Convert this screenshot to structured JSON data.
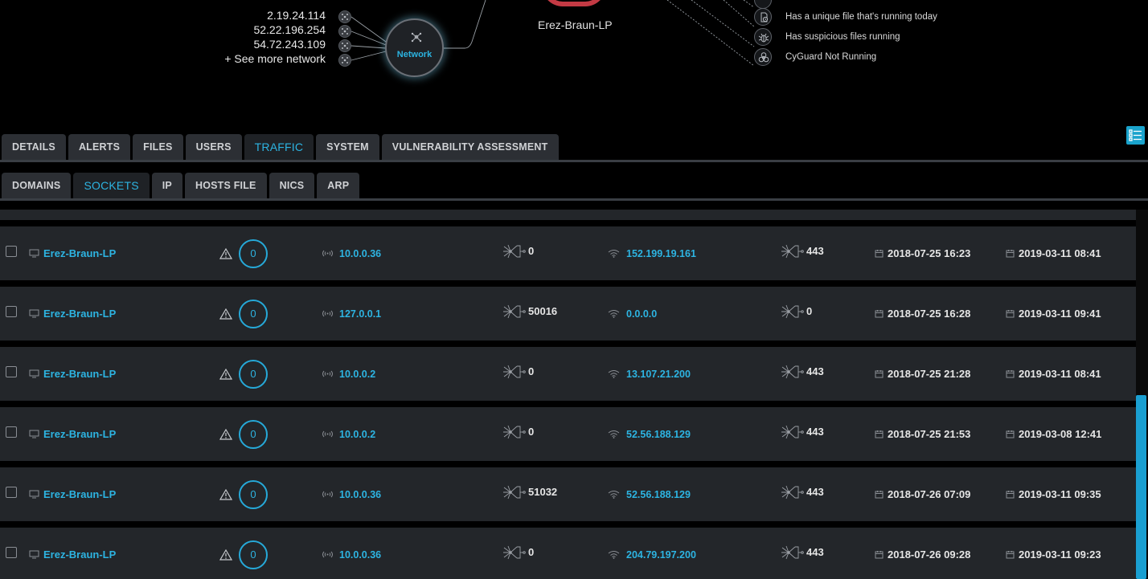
{
  "graph": {
    "network_ips": [
      "2.19.24.114",
      "52.22.196.254",
      "54.72.243.109",
      "+ See more network"
    ],
    "network_label": "Network",
    "host_label": "Erez-Braun-LP",
    "alerts": [
      "Has a unique file that's running today",
      "Has suspicious files running",
      "CyGuard Not Running"
    ]
  },
  "main_tabs": [
    "DETAILS",
    "ALERTS",
    "FILES",
    "USERS",
    "TRAFFIC",
    "SYSTEM",
    "VULNERABILITY ASSESSMENT"
  ],
  "main_tabs_active": "TRAFFIC",
  "sub_tabs": [
    "DOMAINS",
    "SOCKETS",
    "IP",
    "HOSTS FILE",
    "NICS",
    "ARP"
  ],
  "sub_tabs_active": "SOCKETS",
  "rows": [
    {
      "host": "Erez-Braun-LP",
      "alerts": "0",
      "local_ip": "10.0.0.36",
      "local_port": "0",
      "remote_ip": "152.199.19.161",
      "remote_port": "443",
      "first_seen": "2018-07-25 16:23",
      "last_seen": "2019-03-11 08:41"
    },
    {
      "host": "Erez-Braun-LP",
      "alerts": "0",
      "local_ip": "127.0.0.1",
      "local_port": "50016",
      "remote_ip": "0.0.0.0",
      "remote_port": "0",
      "first_seen": "2018-07-25 16:28",
      "last_seen": "2019-03-11 09:41"
    },
    {
      "host": "Erez-Braun-LP",
      "alerts": "0",
      "local_ip": "10.0.0.2",
      "local_port": "0",
      "remote_ip": "13.107.21.200",
      "remote_port": "443",
      "first_seen": "2018-07-25 21:28",
      "last_seen": "2019-03-11 08:41"
    },
    {
      "host": "Erez-Braun-LP",
      "alerts": "0",
      "local_ip": "10.0.0.2",
      "local_port": "0",
      "remote_ip": "52.56.188.129",
      "remote_port": "443",
      "first_seen": "2018-07-25 21:53",
      "last_seen": "2019-03-08 12:41"
    },
    {
      "host": "Erez-Braun-LP",
      "alerts": "0",
      "local_ip": "10.0.0.36",
      "local_port": "51032",
      "remote_ip": "52.56.188.129",
      "remote_port": "443",
      "first_seen": "2018-07-26 07:09",
      "last_seen": "2019-03-11 09:35"
    },
    {
      "host": "Erez-Braun-LP",
      "alerts": "0",
      "local_ip": "10.0.0.36",
      "local_port": "0",
      "remote_ip": "204.79.197.200",
      "remote_port": "443",
      "first_seen": "2018-07-26 09:28",
      "last_seen": "2019-03-11 09:23"
    }
  ],
  "icons": {
    "host": "monitor-icon",
    "alert": "warning-triangle-icon",
    "local_ip": "broadcast-icon",
    "port": "network-port-icon",
    "remote_ip": "wifi-icon",
    "first_seen": "calendar-icon",
    "last_seen": "calendar-icon"
  },
  "colors": {
    "accent": "#2db4e2",
    "row_bg": "#23262a",
    "page_bg": "#000000",
    "danger": "#c33a44"
  }
}
